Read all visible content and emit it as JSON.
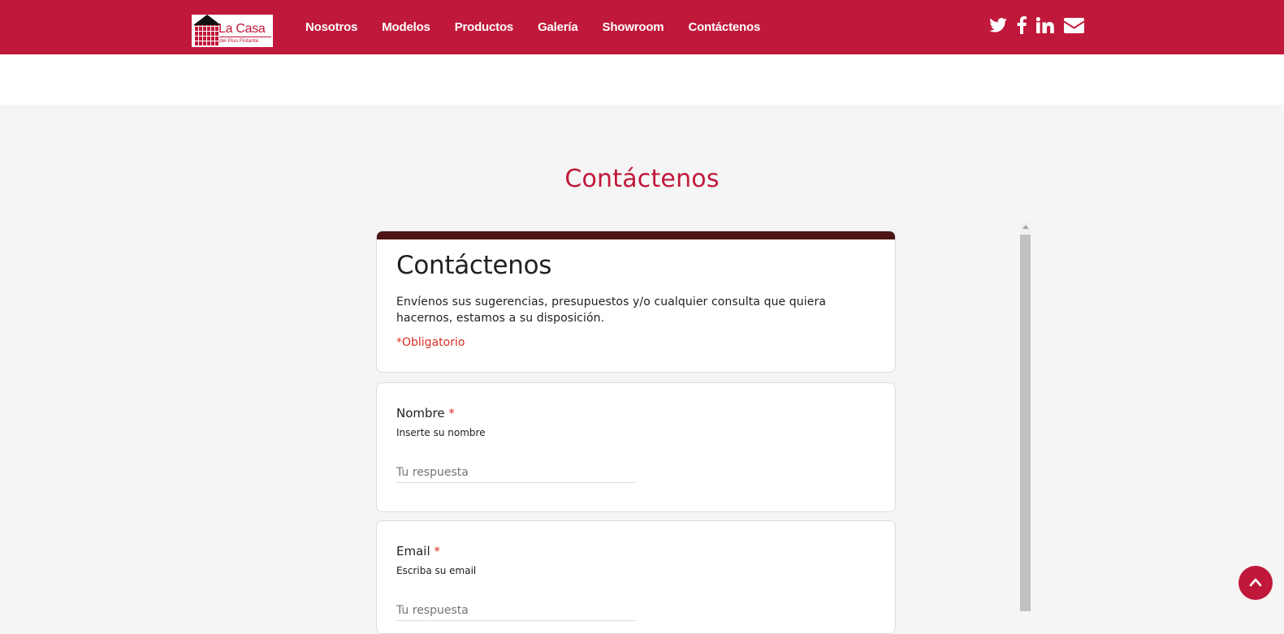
{
  "header": {
    "logo": {
      "title": "La Casa",
      "subtitle": "del Piso Flotante"
    },
    "nav": [
      "Nosotros",
      "Modelos",
      "Productos",
      "Galería",
      "Showroom",
      "Contáctenos"
    ],
    "social_icons": [
      "twitter-icon",
      "facebook-icon",
      "linkedin-icon",
      "envelope-icon"
    ]
  },
  "page": {
    "title": "Contáctenos"
  },
  "form": {
    "title": "Contáctenos",
    "description": "Envíenos sus sugerencias, presupuestos y/o cualquier consulta que quiera hacernos, estamos a su disposición.",
    "required_note": "*Obligatorio",
    "fields": [
      {
        "label": "Nombre",
        "required_mark": "*",
        "help": "Inserte su nombre",
        "placeholder": "Tu respuesta",
        "value": ""
      },
      {
        "label": "Email",
        "required_mark": "*",
        "help": "Escriba su email",
        "placeholder": "Tu respuesta",
        "value": ""
      }
    ]
  },
  "colors": {
    "brand": "#c0183a",
    "form_accent": "#4c1412",
    "required": "#d93025"
  },
  "back_to_top_icon": "chevron-up-icon"
}
